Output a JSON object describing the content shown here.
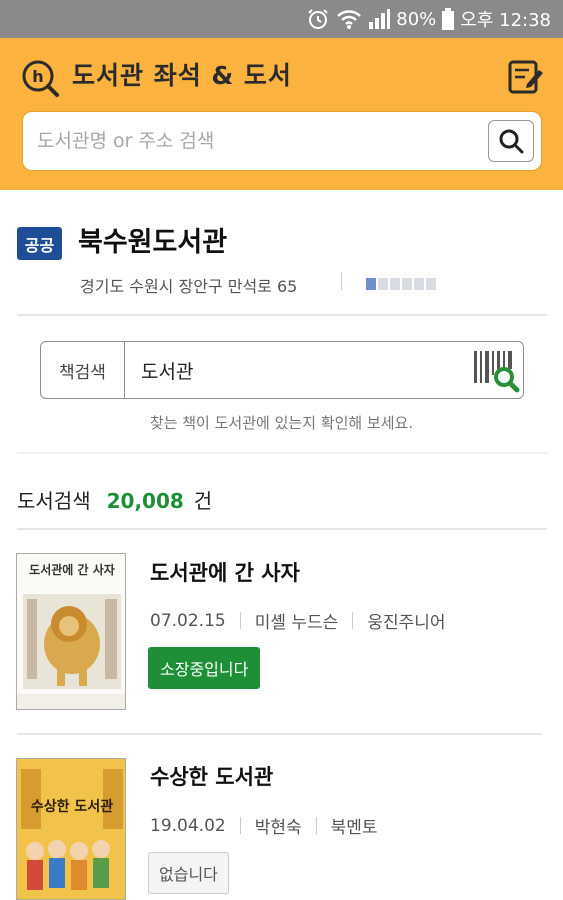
{
  "status_bar": {
    "battery": "80%",
    "time": "오후 12:38"
  },
  "header": {
    "title": "도서관 좌석 & 도서",
    "search_placeholder": "도서관명 or 주소 검색"
  },
  "library": {
    "badge": "공공",
    "name": "북수원도서관",
    "address": "경기도 수원시 장안구 만석로 65",
    "page_dots": 6,
    "active_dot": 0
  },
  "book_search": {
    "label": "책검색",
    "value": "도서관",
    "hint": "찾는 책이 도서관에 있는지 확인해 보세요."
  },
  "results": {
    "label": "도서검색",
    "count": "20,008",
    "unit": "건"
  },
  "books": [
    {
      "title": "도서관에 간 사자",
      "date": "07.02.15",
      "author": "미셸 누드슨",
      "publisher": "웅진주니어",
      "status": "소장중입니다",
      "available": true,
      "cover_text": "도서관에 간 사자"
    },
    {
      "title": "수상한 도서관",
      "date": "19.04.02",
      "author": "박현숙",
      "publisher": "북멘토",
      "status": "없습니다",
      "available": false,
      "cover_text": "수상한 도서관"
    }
  ],
  "colors": {
    "header_bg": "#fbb23e",
    "badge_bg": "#1f4e99",
    "accent_green": "#1e8f37"
  }
}
